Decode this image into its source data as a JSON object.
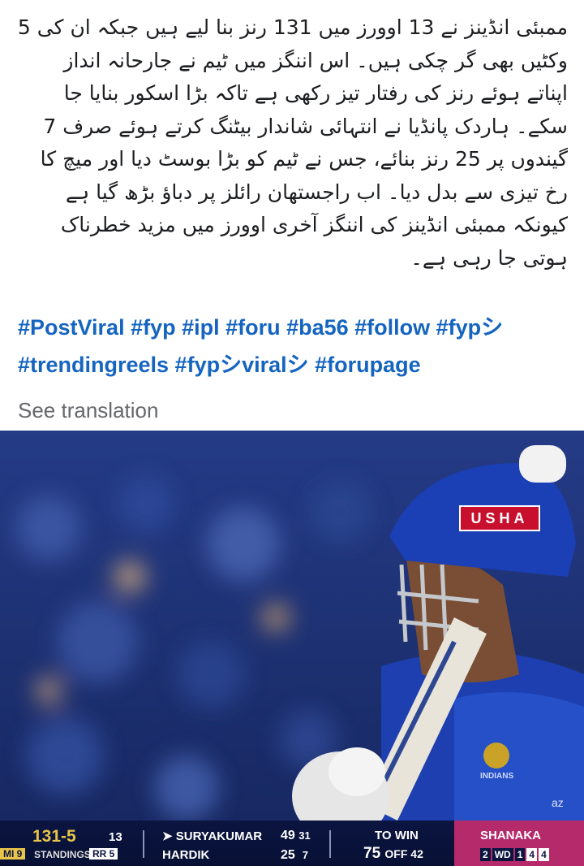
{
  "post": {
    "text": "ممبئی انڈینز نے 13 اوورز میں 131 رنز بنا لیے ہیں جبکہ ان کی 5 وکٹیں بھی گر چکی ہیں۔ اس اننگز میں ٹیم نے جارحانہ انداز اپناتے ہوئے رنز کی رفتار تیز رکھی ہے تاکہ بڑا اسکور بنایا جا سکے۔ ہاردک پانڈیا نے انتہائی شاندار بیٹنگ کرتے ہوئے صرف 7 گیندوں پر 25 رنز بنائے، جس نے ٹیم کو بڑا بوسٹ دیا اور میچ کا رخ تیزی سے بدل دیا۔ اب راجستھان رائلز پر دباؤ بڑھ گیا ہے کیونکہ ممبئی انڈینز کی اننگز آخری اوورز میں مزید خطرناک ہوتی جا رہی ہے۔",
    "hashtags_line1": "#PostViral #fyp #ipl #foru #ba56 #follow #fypシ",
    "hashtags_line2": "#trendingreels #fypシviralシ #forupage",
    "see_translation": "See translation"
  },
  "photo": {
    "helmet_logo": "USHA",
    "jersey_logo": "INDIANS",
    "jersey_text": "az"
  },
  "scorebar": {
    "score": "131-5",
    "overs": "13",
    "mi_badge": "MI 9",
    "standings": "STANDINGS",
    "rr_badge": "RR 5",
    "batter1_name": "➤ SURYAKUMAR",
    "batter1_runs": "49",
    "batter1_balls": "31",
    "batter2_name": "HARDIK",
    "batter2_runs": "25",
    "batter2_balls": "7",
    "to_win_label": "TO WIN",
    "to_win_runs": "75",
    "to_win_off": "OFF 42",
    "bowler_name": "SHANAKA",
    "bowler_figures": [
      "2",
      "WD",
      "1",
      "4",
      "4"
    ]
  },
  "colors": {
    "text": "#1c1e21",
    "hashtag": "#1565c0",
    "muted": "#65676b",
    "scorebar_bg": "#0b1540",
    "score_gold": "#e8c44a",
    "bowler_panel": "#b52a6a",
    "helmet_blue": "#1b3fb5"
  }
}
